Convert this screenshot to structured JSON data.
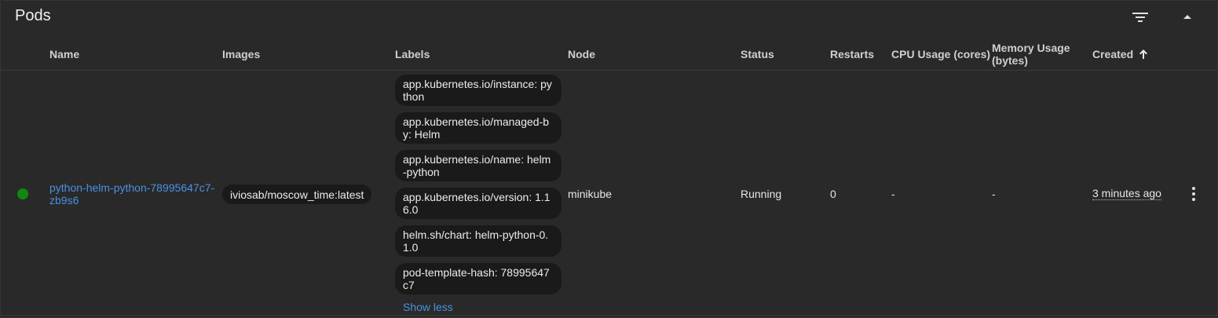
{
  "card": {
    "title": "Pods"
  },
  "columns": {
    "name": "Name",
    "images": "Images",
    "labels": "Labels",
    "node": "Node",
    "status": "Status",
    "restarts": "Restarts",
    "cpu": "CPU Usage (cores)",
    "memory_line1": "Memory Usage",
    "memory_line2": "(bytes)",
    "created": "Created",
    "created_sort_icon": "arrow-up-icon"
  },
  "row": {
    "status_color": "#0f8a0f",
    "name": "python-helm-python-78995647c7-zb9s6",
    "image": "iviosab/moscow_time:latest",
    "labels": [
      "app.kubernetes.io/instance: python",
      "app.kubernetes.io/managed-by: Helm",
      "app.kubernetes.io/name: helm-python",
      "app.kubernetes.io/version: 1.16.0",
      "helm.sh/chart: helm-python-0.1.0",
      "pod-template-hash: 78995647c7"
    ],
    "show_less": "Show less",
    "node": "minikube",
    "status": "Running",
    "restarts": "0",
    "cpu": "-",
    "memory": "-",
    "created": "3 minutes ago"
  },
  "icons": {
    "filter": "filter-icon",
    "collapse": "collapse-icon",
    "actions": "more-vert-icon"
  },
  "colors": {
    "link": "#4a90e2",
    "card_bg": "#292929",
    "chip_bg": "#1a1a1a"
  }
}
